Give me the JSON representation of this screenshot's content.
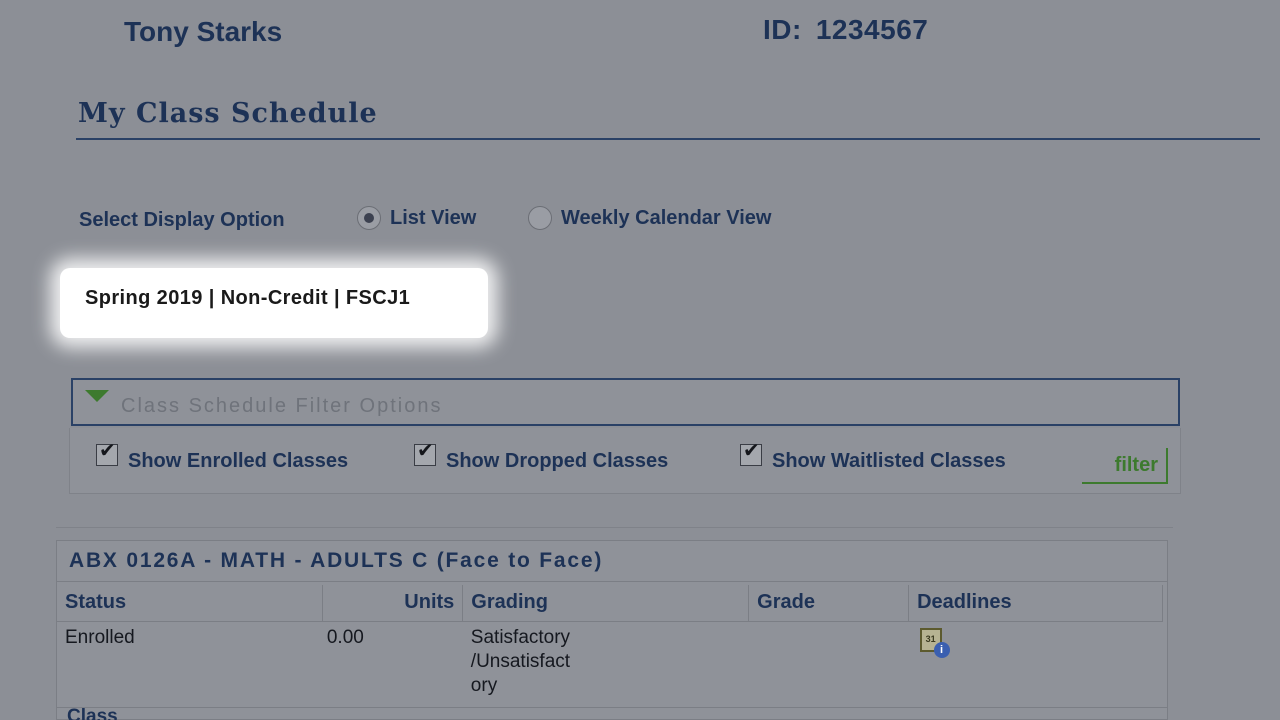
{
  "header": {
    "student_name": "Tony Starks",
    "id_label": "ID:",
    "id_value": "1234567"
  },
  "page": {
    "title": "My Class Schedule"
  },
  "display_options": {
    "label": "Select Display Option",
    "options": [
      {
        "label": "List View",
        "selected": true
      },
      {
        "label": "Weekly Calendar View",
        "selected": false
      }
    ]
  },
  "term": {
    "text": "Spring 2019 | Non-Credit | FSCJ1"
  },
  "filter": {
    "header_label": "Class Schedule Filter Options",
    "checkboxes": [
      {
        "label": "Show Enrolled Classes",
        "checked": true
      },
      {
        "label": "Show Dropped Classes",
        "checked": true
      },
      {
        "label": "Show Waitlisted Classes",
        "checked": true
      }
    ],
    "button_label": "filter"
  },
  "class": {
    "title": "ABX 0126A - MATH - ADULTS C (Face to Face)",
    "columns": [
      "Status",
      "Units",
      "Grading",
      "Grade",
      "Deadlines"
    ],
    "row": {
      "status": "Enrolled",
      "units": "0.00",
      "grading": "Satisfactory\n/Unsatisfact\nory",
      "grade": ""
    },
    "deadline_icon_text": "31",
    "deadline_info_text": "i",
    "next_section_label": "Class"
  },
  "icons": {
    "collapse": "triangle-down-icon",
    "deadline": "calendar-info-icon",
    "check": "✔"
  },
  "colors": {
    "background": "#8c8f96",
    "heading": "#1d3256",
    "highlight": "#ffffff",
    "green": "#3d7a2e"
  }
}
